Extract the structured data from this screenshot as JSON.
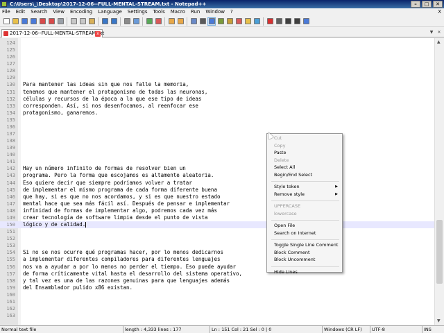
{
  "window": {
    "title": "C:\\Users\\_\\Desktop\\2017-12-06--FULL-MENTAL-STREAM.txt - Notepad++",
    "controls": [
      "–",
      "□",
      "✕"
    ]
  },
  "menubar": {
    "items": [
      "File",
      "Edit",
      "Search",
      "View",
      "Encoding",
      "Language",
      "Settings",
      "Tools",
      "Macro",
      "Run",
      "Window",
      "?"
    ],
    "close_glyph": "X"
  },
  "toolbar": {
    "buttons": [
      {
        "icon": "new-file-icon",
        "color": "#ffffff"
      },
      {
        "icon": "open-file-icon",
        "color": "#e8c04a"
      },
      {
        "icon": "save-icon",
        "color": "#4a7ad8"
      },
      {
        "icon": "save-all-icon",
        "color": "#4a7ad8"
      },
      {
        "icon": "close-icon",
        "color": "#d84a4a"
      },
      {
        "icon": "close-all-icon",
        "color": "#d84a4a"
      },
      {
        "icon": "print-icon",
        "color": "#9aa0a8"
      },
      {
        "sep": true
      },
      {
        "icon": "cut-icon",
        "color": "#c8c8c8"
      },
      {
        "icon": "copy-icon",
        "color": "#c8c8c8"
      },
      {
        "icon": "paste-icon",
        "color": "#d8b058"
      },
      {
        "sep": true
      },
      {
        "icon": "undo-icon",
        "color": "#3a78c8"
      },
      {
        "icon": "redo-icon",
        "color": "#3a78c8"
      },
      {
        "sep": true
      },
      {
        "icon": "find-icon",
        "color": "#8a8a8a"
      },
      {
        "icon": "replace-icon",
        "color": "#6a9ad8"
      },
      {
        "sep": true
      },
      {
        "icon": "zoom-in-icon",
        "color": "#58a858"
      },
      {
        "icon": "zoom-out-icon",
        "color": "#d85858"
      },
      {
        "sep": true
      },
      {
        "icon": "sync-vertical-icon",
        "color": "#e8a848"
      },
      {
        "icon": "sync-horizontal-icon",
        "color": "#e8a848"
      },
      {
        "sep": true
      },
      {
        "icon": "word-wrap-icon",
        "color": "#6a8ac8"
      },
      {
        "icon": "show-all-chars-icon",
        "color": "#5a5a5a"
      },
      {
        "icon": "indent-guide-icon",
        "color": "#4a7ad8",
        "active": true
      },
      {
        "icon": "user-language-icon",
        "color": "#7a9a3a"
      },
      {
        "icon": "document-map-icon",
        "color": "#c8a038"
      },
      {
        "icon": "function-list-icon",
        "color": "#d85a5a"
      },
      {
        "icon": "folder-workspace-icon",
        "color": "#e8c04a"
      },
      {
        "icon": "monitoring-icon",
        "color": "#4aa0d8"
      },
      {
        "sep": true
      },
      {
        "icon": "record-macro-icon",
        "color": "#d83030"
      },
      {
        "icon": "stop-macro-icon",
        "color": "#606060"
      },
      {
        "icon": "play-macro-icon",
        "color": "#404040"
      },
      {
        "icon": "run-macro-multiple-icon",
        "color": "#404040"
      },
      {
        "icon": "save-macro-icon",
        "color": "#4a7ad8"
      }
    ]
  },
  "tabs": [
    {
      "label": "2017-12-06--FULL-MENTAL-STREAM.txt",
      "close": "x"
    }
  ],
  "tab_nav": [
    "▼",
    "✕"
  ],
  "editor": {
    "lines": [
      {
        "n": "124",
        "text": ""
      },
      {
        "n": "125",
        "text": ""
      },
      {
        "n": "126",
        "text": ""
      },
      {
        "n": "127",
        "text": ""
      },
      {
        "n": "128",
        "text": ""
      },
      {
        "n": "129",
        "text": ""
      },
      {
        "n": "130",
        "text": "Para mantener las ideas sin que nos falle la memoria,"
      },
      {
        "n": "131",
        "text": "tenemos que mantener el protagonismo de todas las neuronas,"
      },
      {
        "n": "132",
        "text": "células y recursos de la época a la que ese tipo de ideas"
      },
      {
        "n": "133",
        "text": "corresponden. Así, si nos desenfocamos, al reenfocar ese"
      },
      {
        "n": "134",
        "text": "protagonismo, ganaremos."
      },
      {
        "n": "135",
        "text": ""
      },
      {
        "n": "136",
        "text": ""
      },
      {
        "n": "137",
        "text": ""
      },
      {
        "n": "138",
        "text": ""
      },
      {
        "n": "139",
        "text": ""
      },
      {
        "n": "140",
        "text": ""
      },
      {
        "n": "141",
        "text": ""
      },
      {
        "n": "142",
        "text": "Hay un número infinito de formas de resolver bien un"
      },
      {
        "n": "143",
        "text": "programa. Pero la forma que escojamos es altamente aleatoria."
      },
      {
        "n": "144",
        "text": "Eso quiere decir que siempre podríamos volver a tratar"
      },
      {
        "n": "145",
        "text": "de implementar el mismo programa de cada forma diferente buena"
      },
      {
        "n": "146",
        "text": "que hay, si es que no nos acordamos, y si es que nuestro estado"
      },
      {
        "n": "147",
        "text": "mental hace que sea más fácil así. Después de pensar e implementar"
      },
      {
        "n": "148",
        "text": "infinidad de formas de implementar algo, podremos cada vez más"
      },
      {
        "n": "149",
        "text": "crear tecnología de software limpia desde el punto de vista"
      },
      {
        "n": "150",
        "text": "lógico y de calidad."
      },
      {
        "n": "151",
        "text": ""
      },
      {
        "n": "152",
        "text": ""
      },
      {
        "n": "153",
        "text": ""
      },
      {
        "n": "154",
        "text": "Si no se nos ocurre qué programas hacer, por lo menos dedicarnos"
      },
      {
        "n": "155",
        "text": "a implementar diferentes compiladores para diferentes lenguajes"
      },
      {
        "n": "156",
        "text": "nos va a ayudar a por lo menos no perder el tiempo. Eso puede ayudar"
      },
      {
        "n": "157",
        "text": "de forma críticamente vital hasta el desarrollo del sistema operativo,"
      },
      {
        "n": "158",
        "text": "y tal vez es una de las razones genuinas para que lenguajes además"
      },
      {
        "n": "159",
        "text": "del Ensamblador pulido x86 existan."
      },
      {
        "n": "160",
        "text": ""
      },
      {
        "n": "161",
        "text": ""
      },
      {
        "n": "162",
        "text": ""
      },
      {
        "n": "163",
        "text": ""
      }
    ],
    "current_line": "150",
    "current_line_color": "#e8e8ff"
  },
  "context_menu": {
    "items": [
      {
        "label": "Cut",
        "disabled": true
      },
      {
        "label": "Copy",
        "disabled": true
      },
      {
        "label": "Paste",
        "disabled": false
      },
      {
        "label": "Delete",
        "disabled": true
      },
      {
        "label": "Select All",
        "disabled": false
      },
      {
        "label": "Begin/End Select",
        "disabled": false
      },
      {
        "sep": true
      },
      {
        "label": "Style token",
        "disabled": false,
        "submenu": true
      },
      {
        "label": "Remove style",
        "disabled": false,
        "submenu": true
      },
      {
        "sep": true
      },
      {
        "label": "UPPERCASE",
        "disabled": true
      },
      {
        "label": "lowercase",
        "disabled": true
      },
      {
        "sep": true
      },
      {
        "label": "Open File",
        "disabled": false
      },
      {
        "label": "Search on Internet",
        "disabled": false
      },
      {
        "sep": true
      },
      {
        "label": "Toggle Single Line Comment",
        "disabled": false
      },
      {
        "label": "Block Comment",
        "disabled": false
      },
      {
        "label": "Block Uncomment",
        "disabled": false
      },
      {
        "sep": true
      },
      {
        "label": "Hide Lines",
        "disabled": false
      }
    ],
    "submenu_glyph": "▶"
  },
  "statusbar": {
    "file_type": "Normal text file",
    "length": "length : 4,333    lines : 177",
    "position": "Ln : 151    Col : 21    Sel : 0 | 0",
    "eol": "Windows (CR LF)",
    "encoding": "UTF-8",
    "mode": "INS"
  },
  "scrollbar": {
    "up": "▲",
    "down": "▼"
  }
}
